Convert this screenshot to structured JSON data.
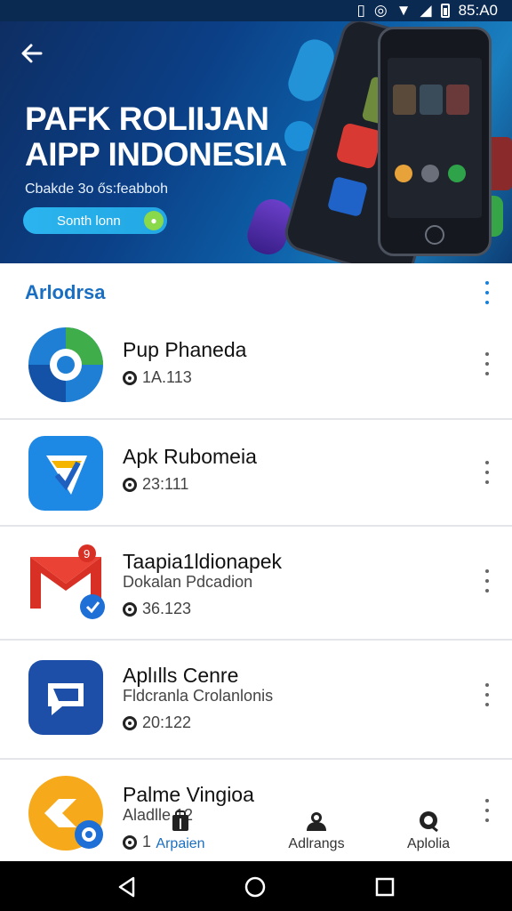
{
  "status_bar": {
    "time": "85:A0"
  },
  "banner": {
    "title_line1": "PAFK ROLIIJAN",
    "title_line2": "AIPP INDONESIA",
    "subtitle": "Cbakde 3o ős:feabboh",
    "cta_label": "Sonth lonn"
  },
  "section": {
    "title": "Arlodrsa"
  },
  "apps": [
    {
      "name": "Pup Phaneda",
      "sub": "",
      "meta": "1A.113"
    },
    {
      "name": "Apk Rubomeia",
      "sub": "",
      "meta": "23:111"
    },
    {
      "name": "Taapia1ldionapek",
      "sub": "Dokalan Pdcadion",
      "meta": "36.123"
    },
    {
      "name": "Aplılls Cenre",
      "sub": "Fldcranla Crolanlonis",
      "meta": "20:122"
    },
    {
      "name": "Palme Vingioa",
      "sub": "Aladlle  12",
      "meta": "1"
    }
  ],
  "bottom_nav": [
    {
      "label": "Arpaien",
      "active": true
    },
    {
      "label": "Adlrangs",
      "active": false
    },
    {
      "label": "Aplolia",
      "active": false
    }
  ],
  "colors": {
    "accent": "#1a6fc2",
    "banner_dark": "#0e2e63",
    "cta": "#2bb4ef"
  }
}
